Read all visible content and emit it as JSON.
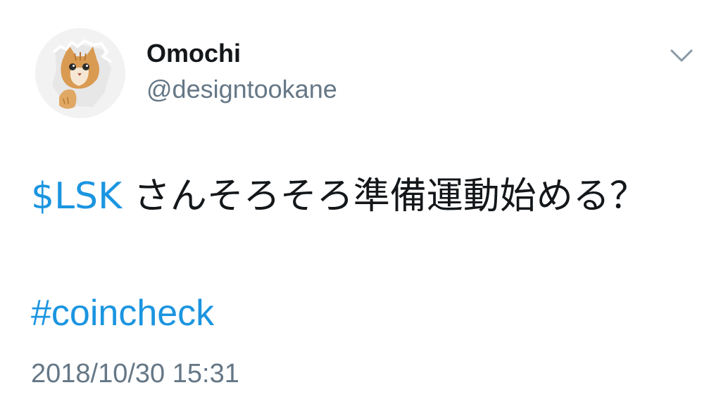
{
  "user": {
    "display_name": "Omochi",
    "handle": "@designtookane"
  },
  "tweet": {
    "cashtag": "$LSK",
    "text": " さんそろそろ準備運動始める？",
    "hashtag": "#coincheck",
    "timestamp": "2018/10/30 15:31"
  },
  "icons": {
    "avatar": "cat-avatar",
    "menu": "chevron-down-icon"
  },
  "colors": {
    "link": "#1b95e0",
    "secondary_text": "#657786",
    "primary_text": "#14171a"
  }
}
